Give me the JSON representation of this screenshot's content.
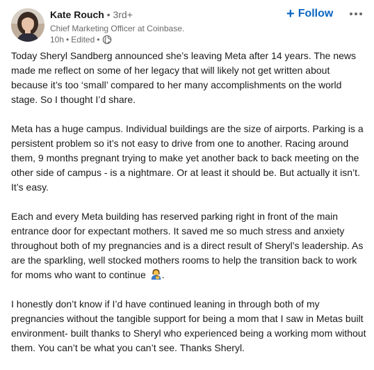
{
  "author": {
    "name": "Kate Rouch",
    "degree": " • 3rd+",
    "headline": "Chief Marketing Officer at Coinbase.",
    "time": "10h",
    "separator_1": "•",
    "edited": "Edited",
    "separator_2": "•",
    "visibility_icon": "globe-icon"
  },
  "actions": {
    "follow_icon": "plus-icon",
    "follow_label": "Follow",
    "more_icon": "more-horizontal-icon"
  },
  "post": {
    "paragraphs": [
      "Today Sheryl Sandberg announced she’s leaving Meta after 14 years. The news made me reflect on some of her legacy that will likely not get written about because it’s too ‘small’ compared to her many accomplishments on the world stage. So I thought I’d share.",
      "Meta has a huge campus. Individual buildings are the size of airports. Parking is a persistent problem so it’s not easy to drive from one to another. Racing around them, 9 months pregnant trying to make yet another back to back meeting on the other side of campus - is a nightmare. Or at least it should be. But actually it isn’t. It’s easy.",
      "Each and every Meta building has reserved parking right in front of the main entrance door for expectant mothers. It saved me so much stress and anxiety throughout both of my pregnancies and is a direct result of Sheryl’s leadership. As are the sparkling, well stocked mothers rooms to help the transition back to work for moms who want to continue",
      "I honestly don’t know if I’d have continued leaning in through both of my pregnancies without the tangible support for being a mom that I saw in Metas built environment- built thanks to Sheryl who experienced being a working mom without them. You can’t be what you can’t see. Thanks Sheryl."
    ],
    "paragraph_3_emoji": "breastfeeding-emoji",
    "paragraph_3_end": "."
  }
}
